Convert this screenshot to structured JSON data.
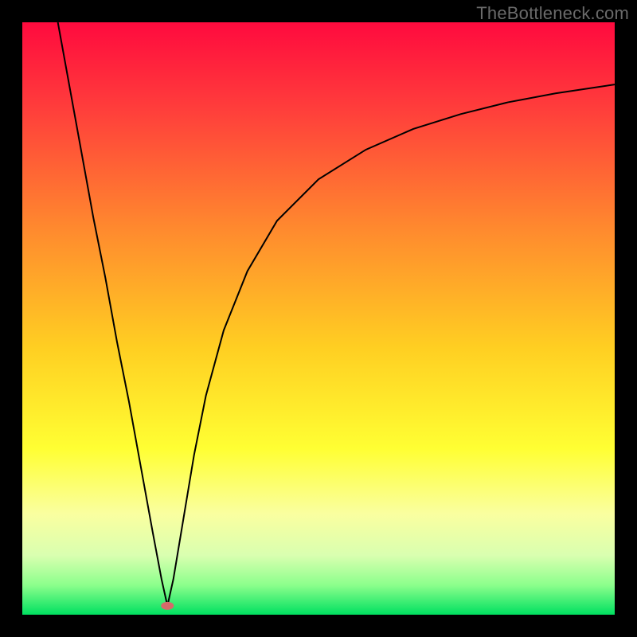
{
  "watermark": "TheBottleneck.com",
  "chart_data": {
    "type": "line",
    "title": "",
    "xlabel": "",
    "ylabel": "",
    "xlim": [
      0,
      100
    ],
    "ylim": [
      0,
      100
    ],
    "grid": false,
    "legend": false,
    "background_gradient": {
      "stops": [
        {
          "offset": 0.0,
          "color": "#ff0a3e"
        },
        {
          "offset": 0.15,
          "color": "#ff3f3b"
        },
        {
          "offset": 0.35,
          "color": "#ff8a2e"
        },
        {
          "offset": 0.55,
          "color": "#ffcf22"
        },
        {
          "offset": 0.72,
          "color": "#ffff33"
        },
        {
          "offset": 0.83,
          "color": "#faffa0"
        },
        {
          "offset": 0.9,
          "color": "#d9ffb0"
        },
        {
          "offset": 0.95,
          "color": "#8cff8c"
        },
        {
          "offset": 1.0,
          "color": "#00e060"
        }
      ]
    },
    "marker": {
      "x": 24.5,
      "y": 1.5,
      "color": "#d66a6a",
      "rx": 8,
      "ry": 5
    },
    "series": [
      {
        "name": "curve",
        "type": "line",
        "stroke": "#000000",
        "stroke_width": 2,
        "x": [
          6,
          8,
          10,
          12,
          14,
          16,
          18,
          20,
          22,
          23.5,
          24.5,
          25.5,
          27,
          29,
          31,
          34,
          38,
          43,
          50,
          58,
          66,
          74,
          82,
          90,
          100
        ],
        "y": [
          100,
          89,
          78,
          67,
          57,
          46,
          36,
          25,
          14,
          6,
          1.5,
          6,
          15,
          27,
          37,
          48,
          58,
          66.5,
          73.5,
          78.5,
          82,
          84.5,
          86.5,
          88,
          89.5
        ]
      }
    ]
  }
}
